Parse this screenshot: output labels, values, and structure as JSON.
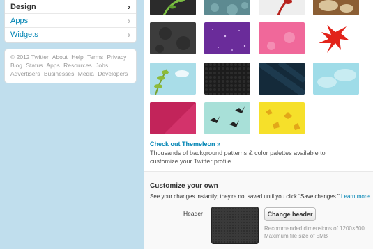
{
  "sidebar": {
    "items": [
      {
        "label": "Design",
        "active": true
      },
      {
        "label": "Apps",
        "active": false
      },
      {
        "label": "Widgets",
        "active": false
      }
    ]
  },
  "footer": {
    "copyright": "© 2012 Twitter",
    "links": [
      "About",
      "Help",
      "Terms",
      "Privacy",
      "Blog",
      "Status",
      "Apps",
      "Resources",
      "Jobs",
      "Advertisers",
      "Businesses",
      "Media",
      "Developers"
    ]
  },
  "themes": {
    "tiles": [
      {
        "name": "theme-dark-leaves",
        "color": "#2b2b2b"
      },
      {
        "name": "theme-blue-gray",
        "color": "#5d8a91"
      },
      {
        "name": "theme-red-leaf-gray",
        "color": "#eeeeee"
      },
      {
        "name": "theme-tan-bird",
        "color": "#8b5e34"
      },
      {
        "name": "theme-dark-damask",
        "color": "#3c3c3c"
      },
      {
        "name": "theme-purple-stars",
        "color": "#6a2c9a"
      },
      {
        "name": "theme-pink-flowers",
        "color": "#f0689a"
      },
      {
        "name": "theme-red-leaf-white",
        "color": "#ffffff"
      },
      {
        "name": "theme-sky-leaves",
        "color": "#a9dde8"
      },
      {
        "name": "theme-black-honeycomb",
        "color": "#1c1c1c"
      },
      {
        "name": "theme-navy-stripes",
        "color": "#142a3a"
      },
      {
        "name": "theme-light-clouds",
        "color": "#9fdce8"
      },
      {
        "name": "theme-magenta",
        "color": "#c2245a"
      },
      {
        "name": "theme-mint-birds",
        "color": "#a8e0d8"
      },
      {
        "name": "theme-yellow-birds",
        "color": "#f6e02a"
      }
    ]
  },
  "themeleon": {
    "link": "Check out Themeleon »",
    "description": "Thousands of background patterns & color palettes available to customize your Twitter profile."
  },
  "customize": {
    "title": "Customize your own",
    "note": "See your changes instantly; they're not saved until you click \"Save changes.\"",
    "learn_more": "Learn more.",
    "header_label": "Header",
    "change_header": "Change header",
    "dimensions": "Recommended dimensions of 1200×600",
    "max_size": "Maximum file size of 5MB"
  }
}
